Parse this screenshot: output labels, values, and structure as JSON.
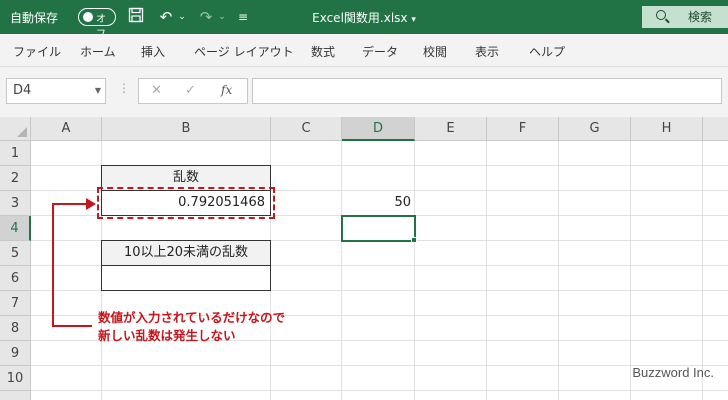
{
  "titlebar": {
    "autosave_label": "自動保存",
    "toggle_label": "オフ",
    "doc_title": "Excel関数用.xlsx",
    "search_label": "検索"
  },
  "ribbon": {
    "tabs": [
      "ファイル",
      "ホーム",
      "挿入",
      "ページ レイアウト",
      "数式",
      "データ",
      "校閲",
      "表示",
      "ヘルプ"
    ]
  },
  "formula_bar": {
    "name_box": "D4",
    "fx_label": "fx",
    "formula": ""
  },
  "grid": {
    "columns": [
      "A",
      "B",
      "C",
      "D",
      "E",
      "F",
      "G",
      "H"
    ],
    "rows": [
      "1",
      "2",
      "3",
      "4",
      "5",
      "6",
      "7",
      "8",
      "9",
      "10"
    ],
    "selected_cell": "D4",
    "cells": {
      "B2": "乱数",
      "B3": "0.792051468",
      "D3": "50",
      "B5": "10以上20未満の乱数",
      "B6": ""
    }
  },
  "annotation": {
    "line1": "数値が入力されているだけなので",
    "line2": "新しい乱数は発生しない",
    "color": "#c4161c"
  },
  "watermark": "Buzzword Inc.",
  "colors": {
    "excel_green": "#217346"
  }
}
